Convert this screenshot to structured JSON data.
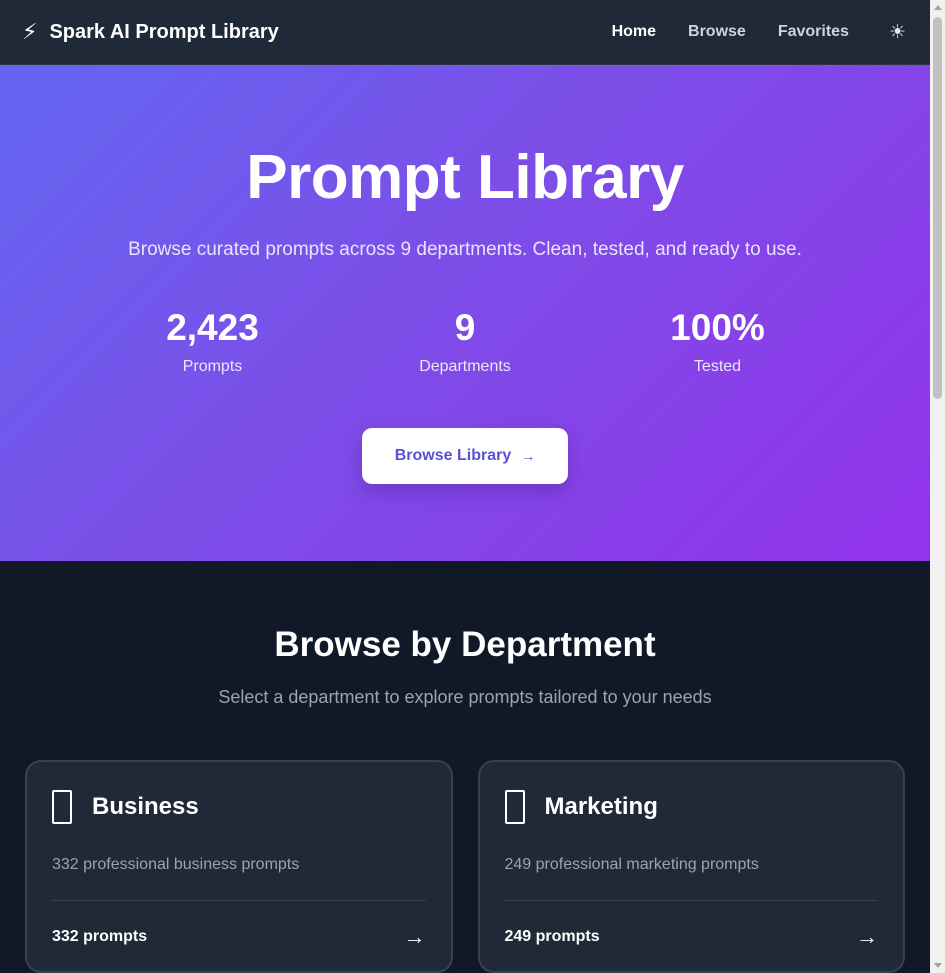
{
  "nav": {
    "brand_icon": "⚡",
    "brand": "Spark AI Prompt Library",
    "links": [
      {
        "label": "Home",
        "active": true
      },
      {
        "label": "Browse",
        "active": false
      },
      {
        "label": "Favorites",
        "active": false
      }
    ],
    "theme_icon": "☀"
  },
  "hero": {
    "title": "Prompt Library",
    "subtitle": "Browse curated prompts across 9 departments. Clean, tested, and ready to use.",
    "stats": [
      {
        "value": "2,423",
        "label": "Prompts"
      },
      {
        "value": "9",
        "label": "Departments"
      },
      {
        "value": "100%",
        "label": "Tested"
      }
    ],
    "button_label": "Browse Library",
    "button_arrow": "→"
  },
  "departments": {
    "title": "Browse by Department",
    "subtitle": "Select a department to explore prompts tailored to your needs",
    "cards": [
      {
        "icon": "briefcase-icon",
        "title": "Business",
        "description": "332 professional business prompts",
        "count": "332 prompts",
        "arrow": "→"
      },
      {
        "icon": "megaphone-icon",
        "title": "Marketing",
        "description": "249 professional marketing prompts",
        "count": "249 prompts",
        "arrow": "→"
      }
    ]
  },
  "colors": {
    "nav_bg": "#1f2937",
    "hero_start": "#6366f1",
    "hero_end": "#9333ea",
    "page_bg": "#111827",
    "card_bg": "#1f2937",
    "button_text": "#5b4fd6"
  }
}
